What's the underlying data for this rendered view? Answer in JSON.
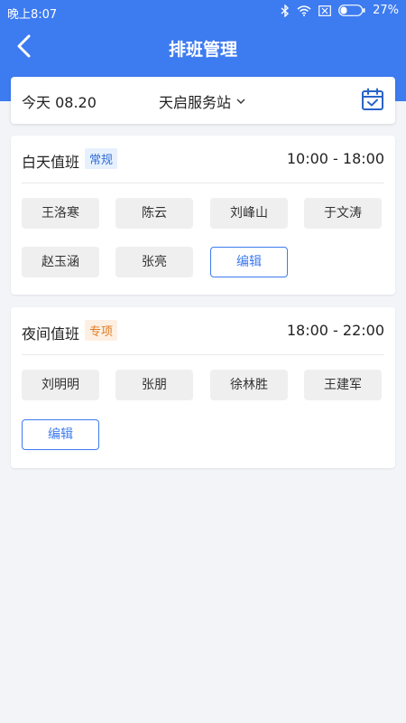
{
  "status": {
    "time": "晚上8:07",
    "battery": "27%"
  },
  "header": {
    "title": "排班管理"
  },
  "datebar": {
    "date": "今天 08.20",
    "station": "天启服务站"
  },
  "shifts": [
    {
      "name": "白天值班",
      "tag": "常规",
      "time": "10:00 - 18:00",
      "people": [
        "王洛寒",
        "陈云",
        "刘峰山",
        "于文涛",
        "赵玉涵",
        "张亮"
      ],
      "edit_label": "编辑"
    },
    {
      "name": "夜间值班",
      "tag": "专项",
      "time": "18:00 - 22:00",
      "people": [
        "刘明明",
        "张朋",
        "徐林胜",
        "王建军"
      ],
      "edit_label": "编辑"
    }
  ],
  "colors": {
    "primary": "#3d7bf0",
    "tag_regular_bg": "#e7f0fd",
    "tag_special_bg": "#fdf0e3",
    "tag_special_text": "#e07a22"
  }
}
